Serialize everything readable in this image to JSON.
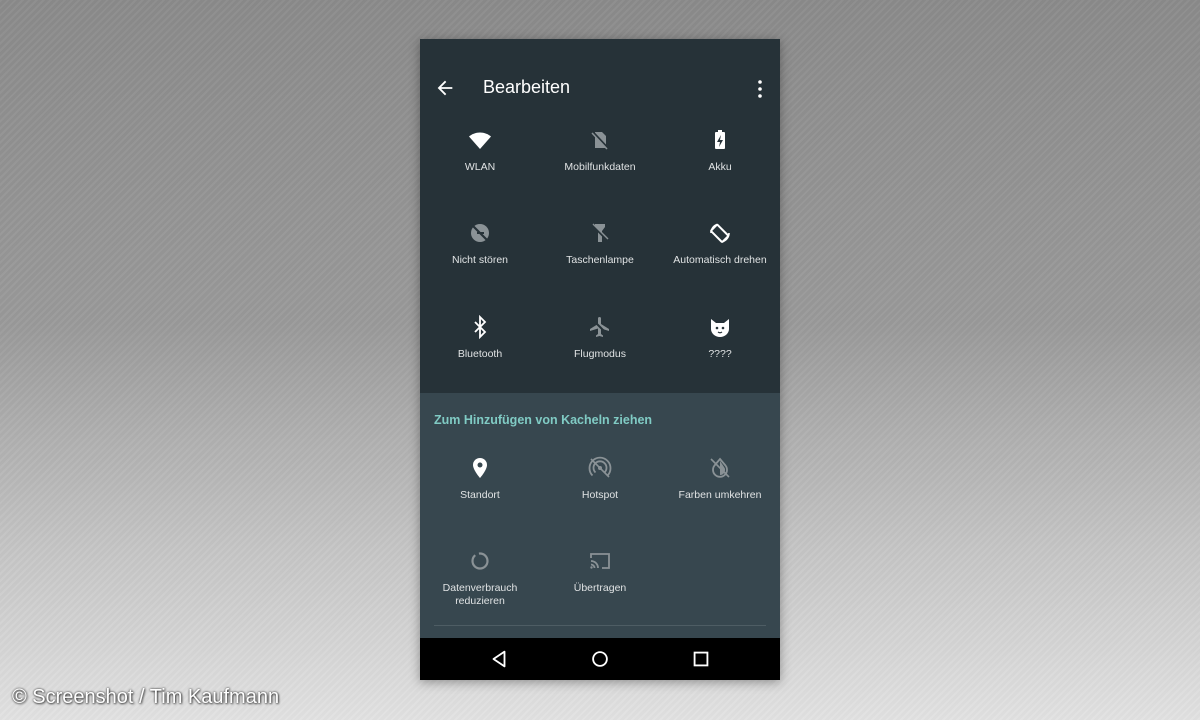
{
  "toolbar": {
    "title": "Bearbeiten"
  },
  "active_tiles": [
    {
      "label": "WLAN",
      "icon": "wifi-icon"
    },
    {
      "label": "Mobilfunkdaten",
      "icon": "mobile-data-off-icon"
    },
    {
      "label": "Akku",
      "icon": "battery-charging-icon"
    },
    {
      "label": "Nicht stören",
      "icon": "do-not-disturb-off-icon"
    },
    {
      "label": "Taschenlampe",
      "icon": "flashlight-off-icon"
    },
    {
      "label": "Automatisch drehen",
      "icon": "auto-rotate-icon"
    },
    {
      "label": "Bluetooth",
      "icon": "bluetooth-icon"
    },
    {
      "label": "Flugmodus",
      "icon": "airplane-off-icon"
    },
    {
      "label": "????",
      "icon": "cat-icon"
    }
  ],
  "add_hint": "Zum Hinzufügen von Kacheln ziehen",
  "available_tiles": [
    {
      "label": "Standort",
      "icon": "location-icon"
    },
    {
      "label": "Hotspot",
      "icon": "hotspot-off-icon"
    },
    {
      "label": "Farben umkehren",
      "icon": "invert-colors-off-icon"
    },
    {
      "label": "Datenverbrauch reduzieren",
      "icon": "data-saver-icon"
    },
    {
      "label": "Übertragen",
      "icon": "cast-icon"
    }
  ],
  "credit": "© Screenshot / Tim Kaufmann",
  "colors": {
    "panel": "#263238",
    "lower_panel": "#37474f",
    "accent": "#80cbc4",
    "icon_on": "#ffffff",
    "icon_off": "#8a9296"
  }
}
